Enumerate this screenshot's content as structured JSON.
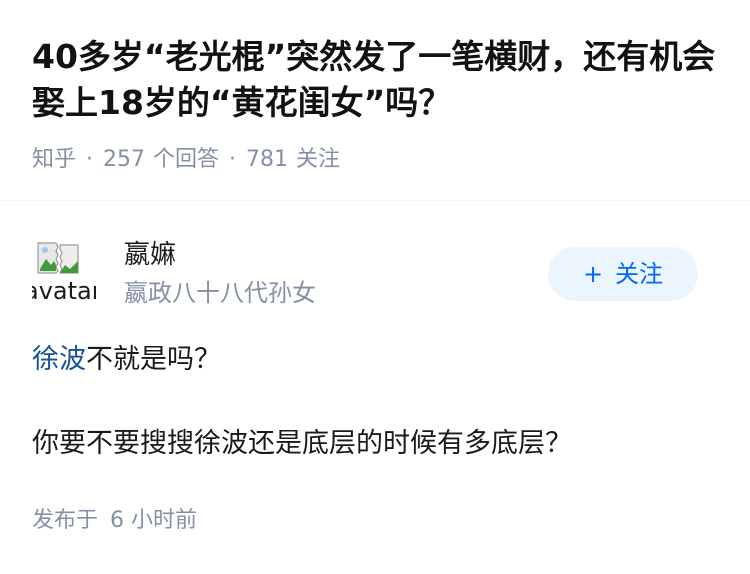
{
  "question": {
    "title": "40多岁“老光棍”突然发了一笔横财，还有机会娶上18岁的“黄花闺女”吗？",
    "source": "知乎",
    "answer_count": "257",
    "answer_label": "个回答",
    "follower_count": "781",
    "follower_label": "关注"
  },
  "answer": {
    "author": {
      "avatar_alt": "avatar",
      "name": "嬴嫲",
      "bio": "嬴政八十八代孙女"
    },
    "follow_button": {
      "icon": "plus-icon",
      "plus": "+",
      "label": "关注"
    },
    "content": {
      "paragraph_1": {
        "link_text": "徐波",
        "rest": "不就是吗？"
      },
      "paragraph_2": "你要不要搜搜徐波还是底层的时候有多底层？"
    },
    "published": {
      "label": "发布于",
      "time": "6 小时前"
    }
  },
  "colors": {
    "title": "#121212",
    "meta": "#8590a6",
    "link": "#175199",
    "follow_text": "#0066ff",
    "follow_bg": "#ebf5fd",
    "divider": "#f0f2f7"
  }
}
